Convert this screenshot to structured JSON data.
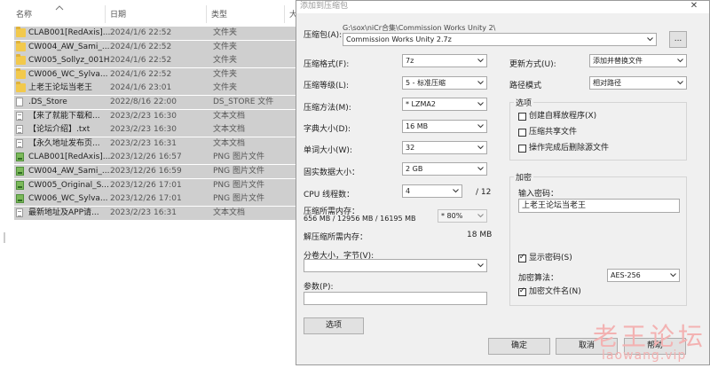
{
  "explorer": {
    "headers": {
      "name": "名称",
      "date": "日期",
      "type": "类型",
      "size": "大"
    },
    "rows": [
      {
        "name": "CLAB001[RedAxis]...",
        "date": "2024/1/6 22:52",
        "type": "文件夹",
        "icon": "folder-icon"
      },
      {
        "name": "CW004_AW_Sami_...",
        "date": "2024/1/6 22:52",
        "type": "文件夹",
        "icon": "folder-icon"
      },
      {
        "name": "CW005_Sollyz_001H",
        "date": "2024/1/6 22:52",
        "type": "文件夹",
        "icon": "folder-icon"
      },
      {
        "name": "CW006_WC_Sylva...",
        "date": "2024/1/6 22:52",
        "type": "文件夹",
        "icon": "folder-icon"
      },
      {
        "name": "上老王论坛当老王",
        "date": "2024/1/6 23:01",
        "type": "文件夹",
        "icon": "folder-icon"
      },
      {
        "name": ".DS_Store",
        "date": "2022/8/16 22:00",
        "type": "DS_STORE 文件",
        "icon": "file-icon"
      },
      {
        "name": "【来了就能下载和...",
        "date": "2023/2/23 16:30",
        "type": "文本文档",
        "icon": "text-file-icon"
      },
      {
        "name": "【论坛介绍】.txt",
        "date": "2023/2/23 16:30",
        "type": "文本文档",
        "icon": "text-file-icon"
      },
      {
        "name": "【永久地址发布页...",
        "date": "2023/2/23 16:31",
        "type": "文本文档",
        "icon": "text-file-icon"
      },
      {
        "name": "CLAB001[RedAxis]...",
        "date": "2023/12/26 16:57",
        "type": "PNG 图片文件",
        "icon": "image-file-icon"
      },
      {
        "name": "CW004_AW_Sami_...",
        "date": "2023/12/26 16:59",
        "type": "PNG 图片文件",
        "icon": "image-file-icon"
      },
      {
        "name": "CW005_Original_S...",
        "date": "2023/12/26 17:01",
        "type": "PNG 图片文件",
        "icon": "image-file-icon"
      },
      {
        "name": "CW006_WC_Sylva...",
        "date": "2023/12/26 17:01",
        "type": "PNG 图片文件",
        "icon": "image-file-icon"
      },
      {
        "name": "最新地址及APP请...",
        "date": "2023/2/23 16:31",
        "type": "文本文档",
        "icon": "text-file-icon"
      }
    ]
  },
  "dialog": {
    "title": "添加到压缩包",
    "close": "✕",
    "archive_label": "压缩包(A):",
    "archive_path": "G:\\sox\\niCr合集\\Commission Works Unity 2\\",
    "archive_name": "Commission Works Unity 2.7z",
    "browse": "...",
    "left": {
      "format": {
        "label": "压缩格式(F):",
        "value": "7z"
      },
      "level": {
        "label": "压缩等级(L):",
        "value": "5 - 标准压缩"
      },
      "method": {
        "label": "压缩方法(M):",
        "value": "* LZMA2"
      },
      "dict": {
        "label": "字典大小(D):",
        "value": "16 MB"
      },
      "word": {
        "label": "单词大小(W):",
        "value": "32"
      },
      "solid": {
        "label": "固实数据大小：",
        "value": "2 GB"
      },
      "cpu": {
        "label": "CPU 线程数：",
        "value": "4",
        "of": "/ 12"
      },
      "mem_comp": {
        "label": "压缩所需内存：",
        "value": "656 MB / 12956 MB / 16195 MB",
        "pct": "* 80%"
      },
      "mem_decomp": {
        "label": "解压缩所需内存：",
        "value": "18 MB"
      },
      "volume": {
        "label": "分卷大小，字节(V):",
        "value": ""
      },
      "params": {
        "label": "参数(P):",
        "value": ""
      },
      "options_button": "选项"
    },
    "right": {
      "update": {
        "label": "更新方式(U):",
        "value": "添加并替换文件"
      },
      "path": {
        "label": "路径模式",
        "value": "相对路径"
      },
      "options_group": "选项",
      "sfx": {
        "label": "创建自释放程序(X)",
        "checked": false
      },
      "shared": {
        "label": "压缩共享文件",
        "checked": false
      },
      "delete": {
        "label": "操作完成后删除源文件",
        "checked": false
      },
      "encrypt_group": "加密",
      "password_label": "输入密码：",
      "password_value": "上老王论坛当老王",
      "show_password": {
        "label": "显示密码(S)",
        "checked": true
      },
      "algo_label": "加密算法：",
      "algo_value": "AES-256",
      "encrypt_names": {
        "label": "加密文件名(N)",
        "checked": true
      }
    },
    "buttons": {
      "ok": "确定",
      "cancel": "取消",
      "help": "帮助"
    },
    "checkmark": "✓"
  },
  "watermark": {
    "line1": "老王论坛",
    "line2": "laowang.vip"
  }
}
